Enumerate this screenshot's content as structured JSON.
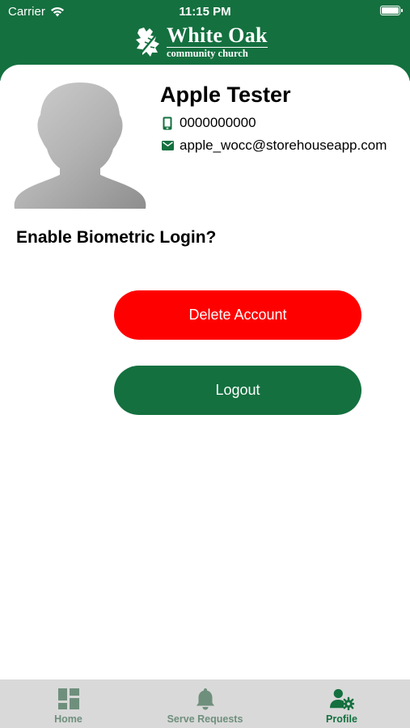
{
  "status_bar": {
    "carrier": "Carrier",
    "time": "11:15 PM"
  },
  "header": {
    "logo_title": "White Oak",
    "logo_subtitle": "community church"
  },
  "profile": {
    "name": "Apple Tester",
    "phone": "0000000000",
    "email": "apple_wocc@storehouseapp.com",
    "avatar": "default-avatar-silhouette"
  },
  "settings": {
    "biometric_label": "Enable Biometric Login?"
  },
  "actions": {
    "delete_label": "Delete Account",
    "logout_label": "Logout"
  },
  "tab_bar": {
    "items": [
      {
        "label": "Home",
        "icon": "dashboard-grid-icon",
        "active": false
      },
      {
        "label": "Serve Requests",
        "icon": "bell-icon",
        "active": false
      },
      {
        "label": "Profile",
        "icon": "user-settings-icon",
        "active": true
      }
    ]
  },
  "colors": {
    "brand_green": "#14703f",
    "danger_red": "#ff0000",
    "tab_bar_bg": "#d9d9d9",
    "inactive_tab": "#6f8f7d"
  }
}
